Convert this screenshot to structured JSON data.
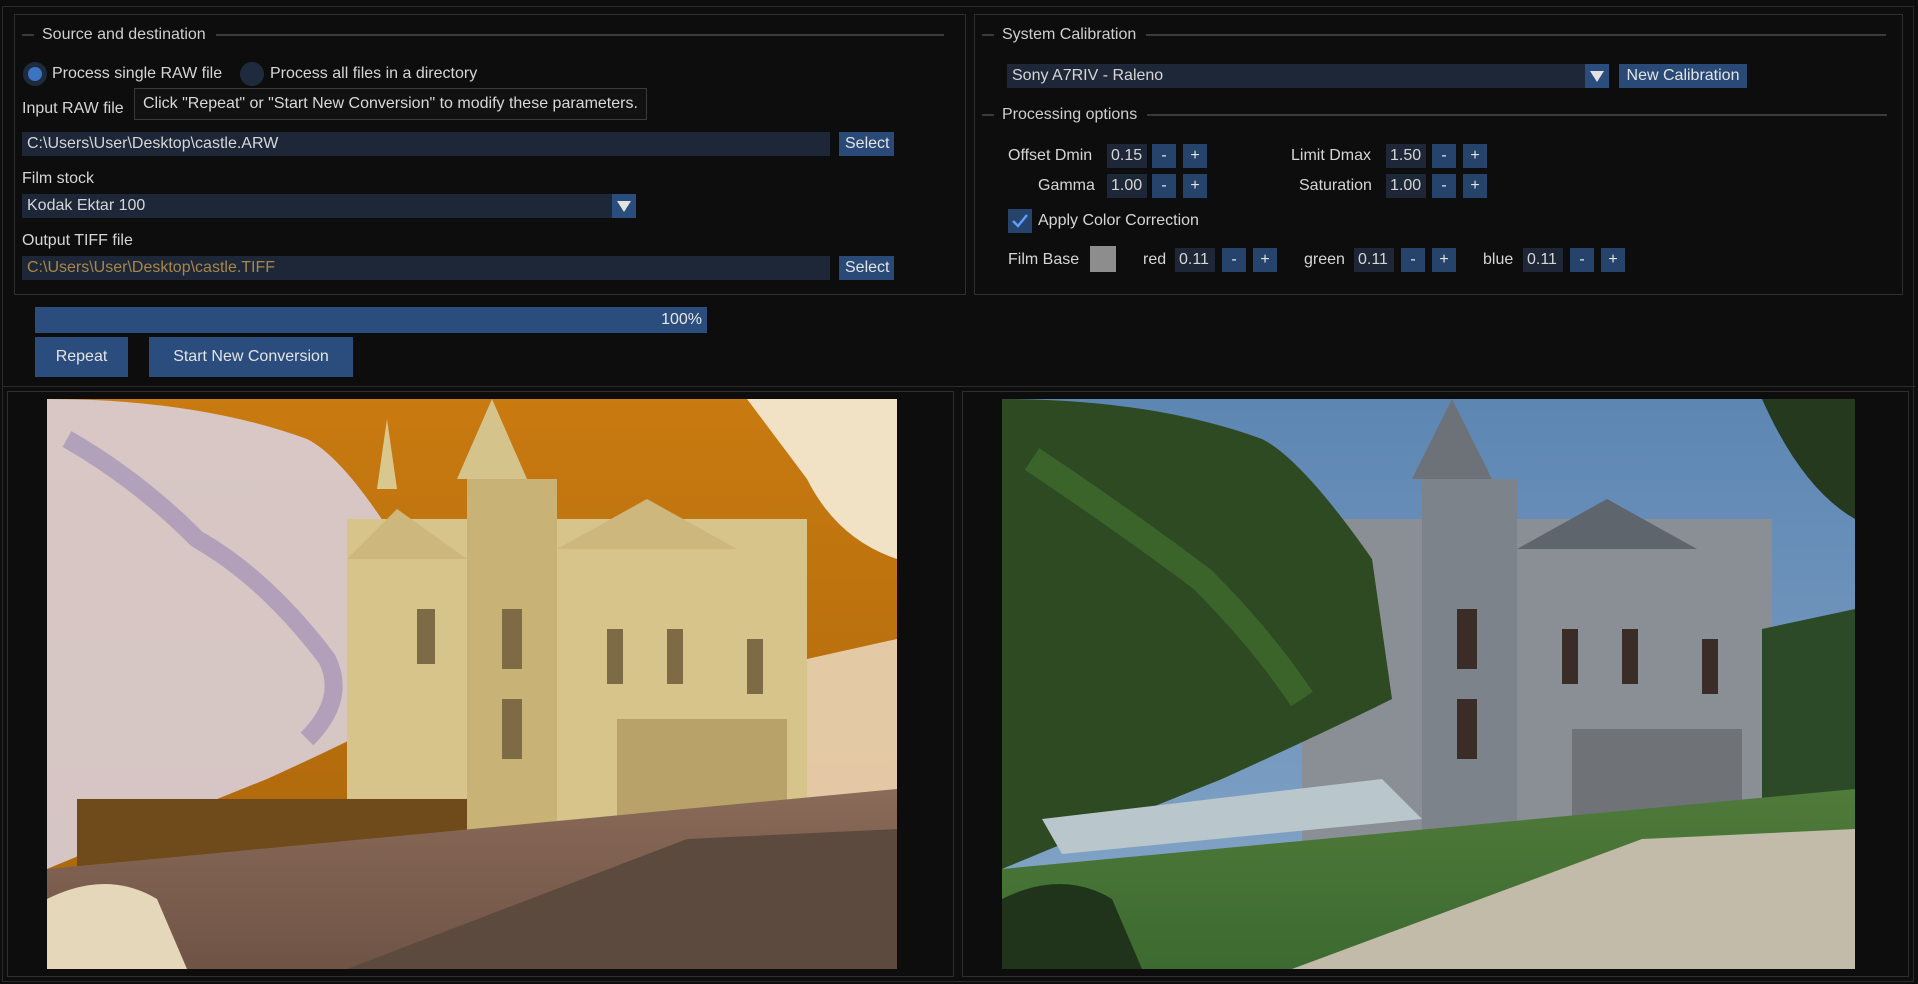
{
  "source": {
    "legend": "Source and destination",
    "radio_single": "Process single RAW file",
    "radio_directory": "Process all files in a directory",
    "input_label": "Input RAW file",
    "tooltip": "Click \"Repeat\" or \"Start New Conversion\" to modify these parameters.",
    "input_path": "C:\\Users\\User\\Desktop\\castle.ARW",
    "select_label": "Select",
    "film_stock_label": "Film stock",
    "film_stock_value": "Kodak Ektar 100",
    "output_label": "Output TIFF file",
    "output_path": "C:\\Users\\User\\Desktop\\castle.TIFF"
  },
  "calibration": {
    "legend": "System Calibration",
    "camera_value": "Sony A7RIV - Raleno",
    "new_button": "New Calibration"
  },
  "processing": {
    "legend": "Processing options",
    "offset_dmin_label": "Offset Dmin",
    "offset_dmin_value": "0.15",
    "limit_dmax_label": "Limit Dmax",
    "limit_dmax_value": "1.50",
    "gamma_label": "Gamma",
    "gamma_value": "1.00",
    "saturation_label": "Saturation",
    "saturation_value": "1.00",
    "color_correction_label": "Apply Color Correction",
    "color_correction_checked": true,
    "film_base_label": "Film Base",
    "film_base_color": "#8d8d8d",
    "red_label": "red",
    "red_value": "0.11",
    "green_label": "green",
    "green_value": "0.11",
    "blue_label": "blue",
    "blue_value": "0.11",
    "minus": "-",
    "plus": "+"
  },
  "progress": {
    "percent": 100,
    "text": "100%"
  },
  "actions": {
    "repeat": "Repeat",
    "start_new": "Start New Conversion"
  },
  "colors": {
    "accent": "#2a4d7d",
    "field_bg": "#1d2738",
    "background": "#0d0d0e"
  }
}
